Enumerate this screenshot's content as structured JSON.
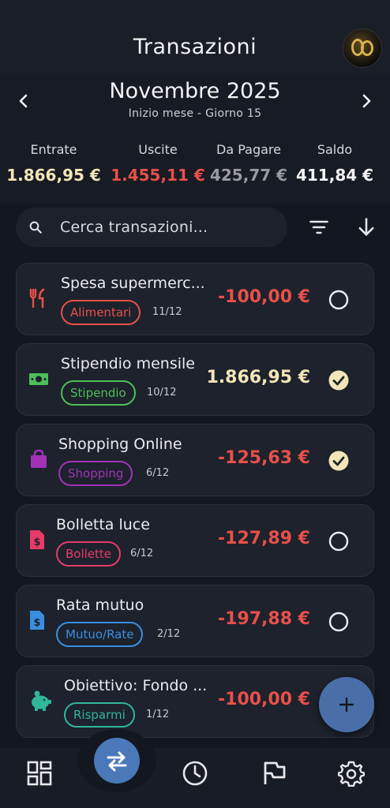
{
  "header": {
    "title": "Transazioni",
    "avatar_icon": "avatar-image"
  },
  "period": {
    "month_title": "Novembre 2025",
    "subtitle": "Inizio mese - Giorno 15",
    "prev_icon": "chevron-left-icon",
    "next_icon": "chevron-right-icon"
  },
  "summary": [
    {
      "label": "Entrate",
      "value": "1.866,95 €",
      "color": "#f2e6b8"
    },
    {
      "label": "Uscite",
      "value": "1.455,11 €",
      "color": "#e8504a"
    },
    {
      "label": "Da Pagare",
      "value": "425,77 €",
      "color": "#9a9ba0"
    },
    {
      "label": "Saldo",
      "value": "411,84 €",
      "color": "#f4f4f6"
    }
  ],
  "search": {
    "placeholder": "Cerca transazioni..."
  },
  "transactions": [
    {
      "name": "Spesa supermerc...",
      "category": "Alimentari",
      "date": "11/12",
      "amount": "-100,00 €",
      "amount_color": "#e8504a",
      "category_color": "#e8504a",
      "icon": "cutlery-icon",
      "paid": false
    },
    {
      "name": "Stipendio mensile",
      "category": "Stipendio",
      "date": "10/12",
      "amount": "1.866,95 €",
      "amount_color": "#f2e6b8",
      "category_color": "#4cbf57",
      "icon": "money-icon",
      "paid": true
    },
    {
      "name": "Shopping Online",
      "category": "Shopping",
      "date": "6/12",
      "amount": "-125,63 €",
      "amount_color": "#e8504a",
      "category_color": "#a132b8",
      "icon": "shopping-bag-icon",
      "paid": true
    },
    {
      "name": "Bolletta luce",
      "category": "Bollette",
      "date": "6/12",
      "amount": "-127,89 €",
      "amount_color": "#e8504a",
      "category_color": "#e83a68",
      "icon": "invoice-icon",
      "paid": false
    },
    {
      "name": "Rata mutuo",
      "category": "Mutuo/Rate",
      "date": "2/12",
      "amount": "-197,88 €",
      "amount_color": "#e8504a",
      "category_color": "#3a8ee0",
      "icon": "invoice-icon",
      "paid": false
    },
    {
      "name": "Obiettivo: Fondo ...",
      "category": "Risparmi",
      "date": "1/12",
      "amount": "-100,00 €",
      "amount_color": "#e8504a",
      "category_color": "#2fb79a",
      "icon": "piggy-bank-icon",
      "paid": false
    }
  ],
  "bottom_nav": [
    "dashboard-icon",
    "transfer-icon",
    "history-icon",
    "goals-flag-icon",
    "settings-gear-icon"
  ],
  "fab": {
    "icon": "plus-icon"
  }
}
